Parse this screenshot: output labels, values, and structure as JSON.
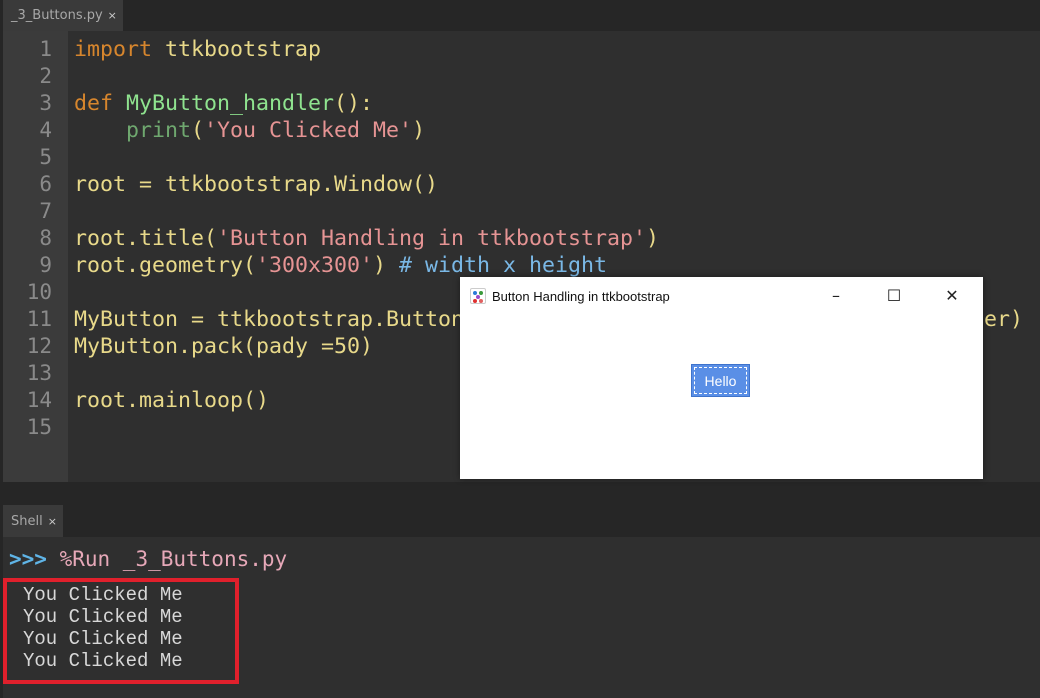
{
  "editor": {
    "tab_label": "_3_Buttons.py",
    "tab_close": "×",
    "lines": [
      [
        {
          "t": "import ",
          "c": "kw"
        },
        {
          "t": "ttkbootstrap",
          "c": ""
        }
      ],
      [],
      [
        {
          "t": "def ",
          "c": "kw"
        },
        {
          "t": "MyButton_handler",
          "c": "fn"
        },
        {
          "t": "():",
          "c": ""
        }
      ],
      [
        {
          "t": "    ",
          "c": ""
        },
        {
          "t": "print",
          "c": "bi"
        },
        {
          "t": "(",
          "c": ""
        },
        {
          "t": "'You Clicked Me'",
          "c": "st"
        },
        {
          "t": ")",
          "c": ""
        }
      ],
      [],
      [
        {
          "t": "root = ttkbootstrap.Window()",
          "c": ""
        }
      ],
      [],
      [
        {
          "t": "root.title(",
          "c": ""
        },
        {
          "t": "'Button Handling in ttkbootstrap'",
          "c": "st"
        },
        {
          "t": ")",
          "c": ""
        }
      ],
      [
        {
          "t": "root.geometry(",
          "c": ""
        },
        {
          "t": "'300x300'",
          "c": "st"
        },
        {
          "t": ") ",
          "c": ""
        },
        {
          "t": "# width x height",
          "c": "cm"
        }
      ],
      [],
      [
        {
          "t": "MyButton = ttkbootstrap.Button                                        er)",
          "c": ""
        }
      ],
      [
        {
          "t": "MyButton.pack(pady =50)",
          "c": ""
        }
      ],
      [],
      [
        {
          "t": "root.mainloop()",
          "c": ""
        }
      ],
      []
    ]
  },
  "shell": {
    "tab_label": "Shell",
    "tab_close": "×",
    "prompt": ">>>",
    "command": " %Run _3_Buttons.py",
    "output": [
      "You Clicked Me",
      "You Clicked Me",
      "You Clicked Me",
      "You Clicked Me"
    ]
  },
  "window": {
    "title": "Button Handling in ttkbootstrap",
    "minimize": "–",
    "maximize": "☐",
    "close": "✕",
    "button_label": "Hello"
  }
}
